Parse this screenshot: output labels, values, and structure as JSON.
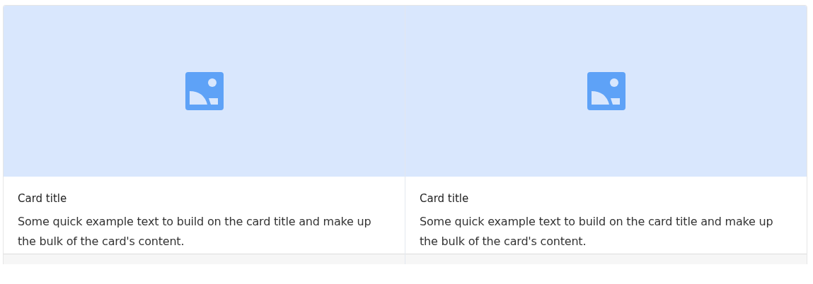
{
  "cards": [
    {
      "image": {
        "kind": "placeholder"
      },
      "title": "Card title",
      "text": "Some quick example text to build on the card title and make up the bulk of the card's content."
    },
    {
      "image": {
        "kind": "placeholder"
      },
      "title": "Card title",
      "text": "Some quick example text to build on the card title and make up the bulk of the card's content."
    }
  ]
}
